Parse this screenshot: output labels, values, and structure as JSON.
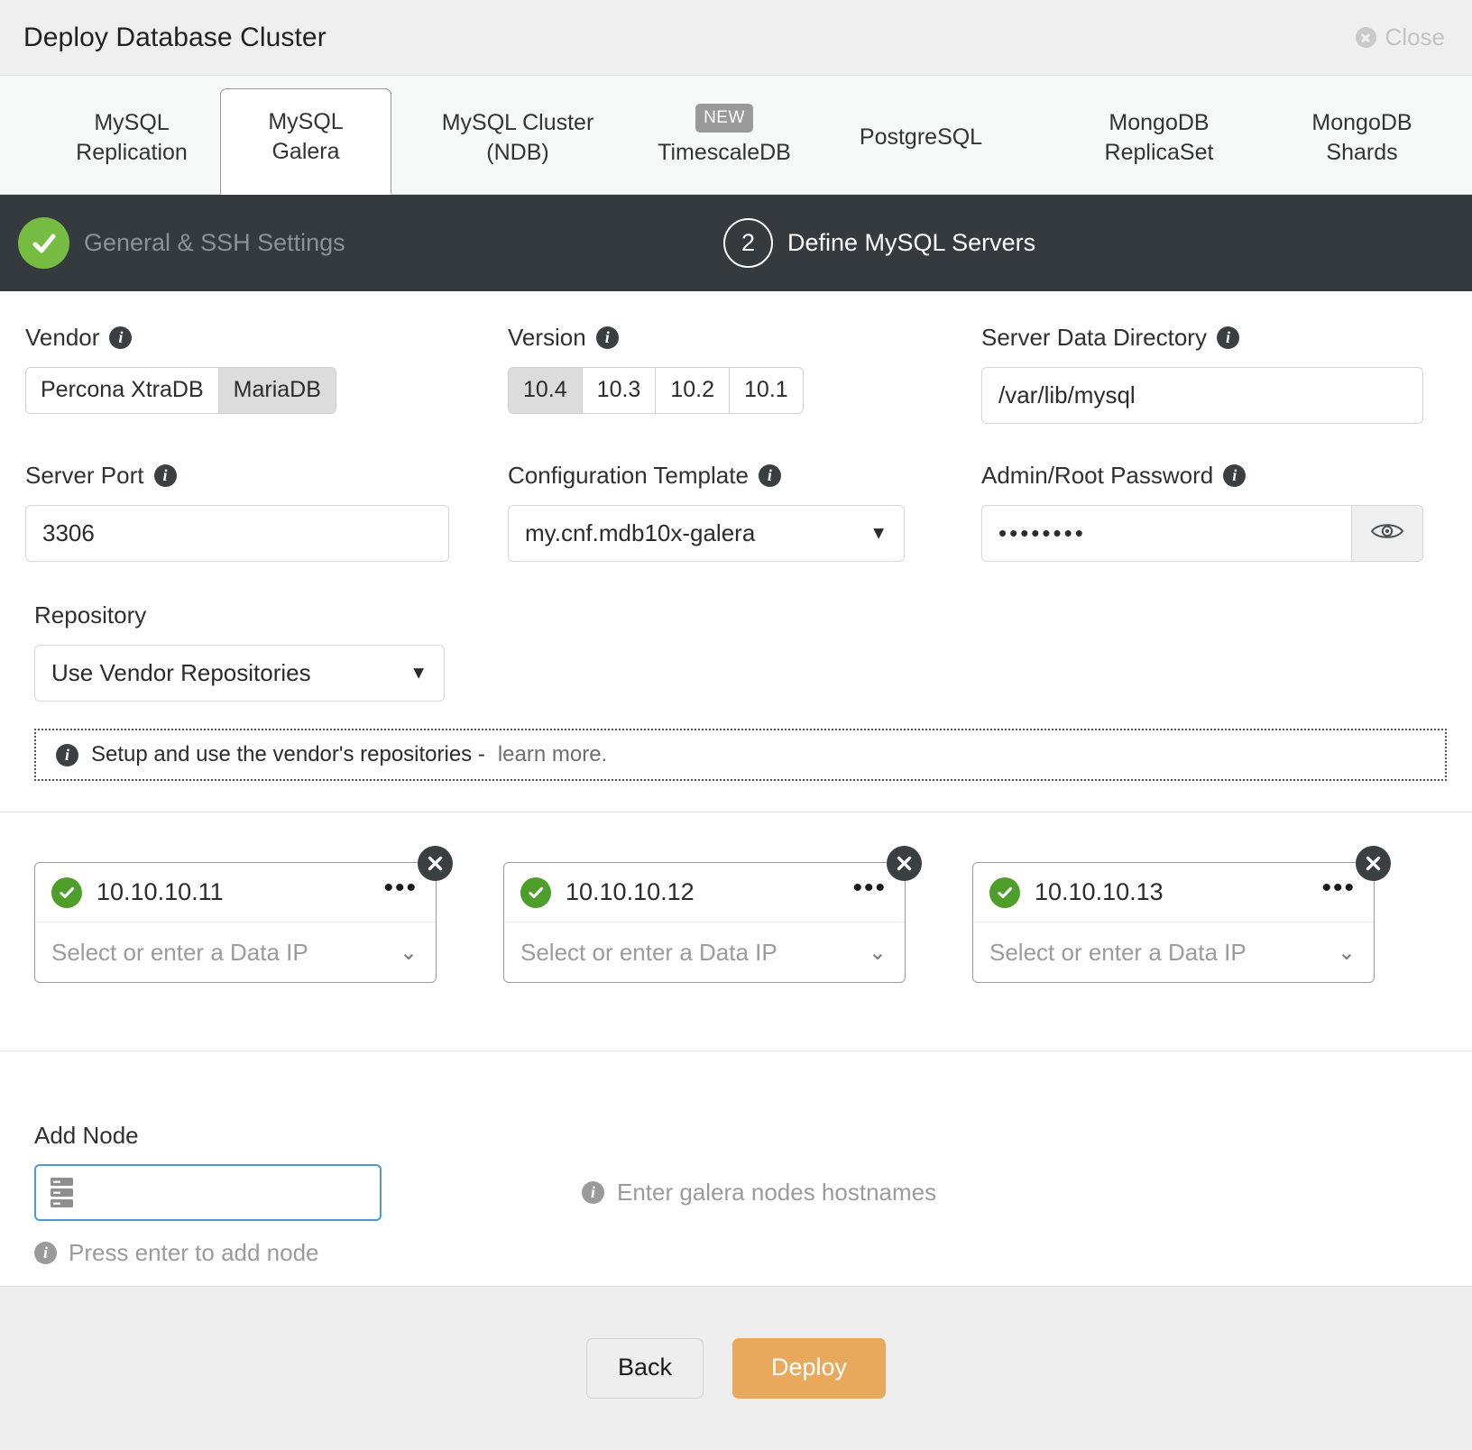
{
  "window": {
    "title": "Deploy Database Cluster",
    "close_label": "Close"
  },
  "tabs": [
    {
      "line1": "MySQL",
      "line2": "Replication",
      "badge": "",
      "active": false
    },
    {
      "line1": "MySQL",
      "line2": "Galera",
      "badge": "",
      "active": true
    },
    {
      "line1": "MySQL Cluster",
      "line2": "(NDB)",
      "badge": "",
      "active": false
    },
    {
      "line1": "TimescaleDB",
      "line2": "",
      "badge": "NEW",
      "active": false
    },
    {
      "line1": "PostgreSQL",
      "line2": "",
      "badge": "",
      "active": false
    },
    {
      "line1": "MongoDB",
      "line2": "ReplicaSet",
      "badge": "",
      "active": false
    },
    {
      "line1": "MongoDB",
      "line2": "Shards",
      "badge": "",
      "active": false
    }
  ],
  "steps": [
    {
      "label": "General & SSH Settings",
      "state": "done",
      "number": ""
    },
    {
      "label": "Define MySQL Servers",
      "state": "active",
      "number": "2"
    }
  ],
  "form": {
    "vendor": {
      "label": "Vendor",
      "options": [
        "Percona XtraDB",
        "MariaDB"
      ],
      "selected": "MariaDB"
    },
    "version": {
      "label": "Version",
      "options": [
        "10.4",
        "10.3",
        "10.2",
        "10.1"
      ],
      "selected": "10.4"
    },
    "data_directory": {
      "label": "Server Data Directory",
      "value": "/var/lib/mysql"
    },
    "server_port": {
      "label": "Server Port",
      "value": "3306"
    },
    "config_template": {
      "label": "Configuration Template",
      "value": "my.cnf.mdb10x-galera"
    },
    "admin_password": {
      "label": "Admin/Root Password",
      "value": "••••••••"
    },
    "repository": {
      "label": "Repository",
      "value": "Use Vendor Repositories"
    },
    "repository_notice": {
      "text": "Setup and use the vendor's repositories - ",
      "link": "learn more."
    }
  },
  "nodes": [
    {
      "ip": "10.10.10.11",
      "data_ip_placeholder": "Select or enter a Data IP",
      "status": "ok"
    },
    {
      "ip": "10.10.10.12",
      "data_ip_placeholder": "Select or enter a Data IP",
      "status": "ok"
    },
    {
      "ip": "10.10.10.13",
      "data_ip_placeholder": "Select or enter a Data IP",
      "status": "ok"
    }
  ],
  "add_node": {
    "label": "Add Node",
    "value": "",
    "placeholder": "",
    "hint": "Enter galera nodes hostnames",
    "helper": "Press enter to add node"
  },
  "footer": {
    "back_label": "Back",
    "deploy_label": "Deploy"
  },
  "colors": {
    "accent_deploy": "#e9a95c",
    "step_done": "#76bc43",
    "node_ok": "#4d9e2a",
    "stepbar_bg": "#343a3d",
    "focus_border": "#4a9bd4"
  }
}
